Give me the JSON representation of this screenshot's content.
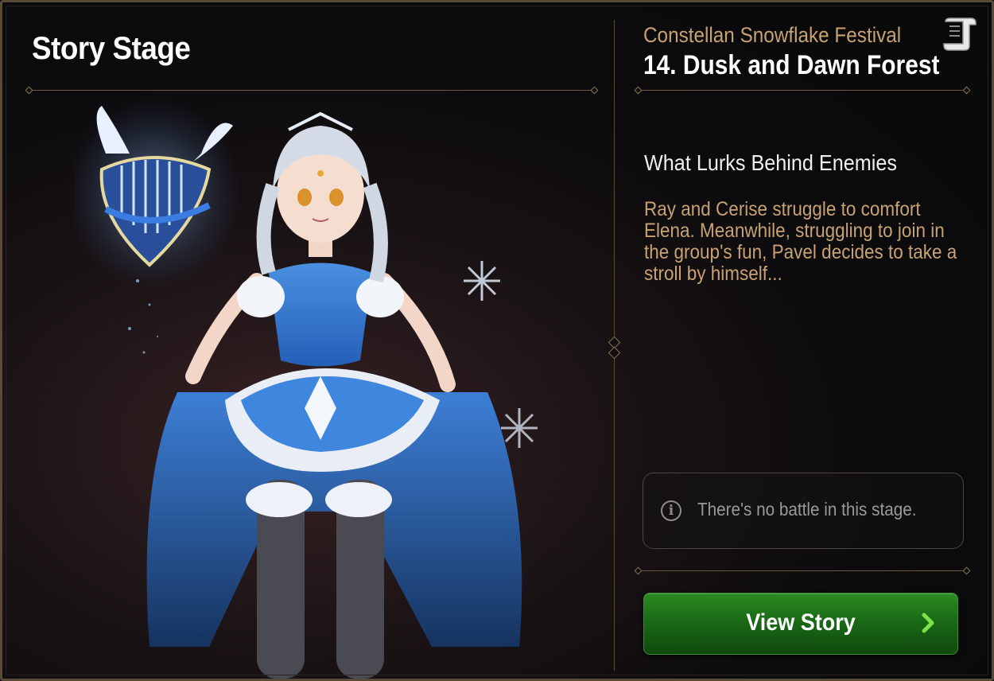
{
  "header": {
    "title": "Story Stage"
  },
  "stage": {
    "event_name": "Constellan Snowflake Festival",
    "stage_name": "14. Dusk and Dawn Forest"
  },
  "story": {
    "heading": "What Lurks Behind Enemies",
    "description": "Ray and Cerise struggle to comfort Elena. Meanwhile, struggling to join in the group's fun, Pavel decides to take a stroll by himself..."
  },
  "notice": {
    "text": "There's no battle in this stage.",
    "icon": "info-icon"
  },
  "actions": {
    "view_story_label": "View Story"
  },
  "colors": {
    "accent": "#c8a272",
    "button_green": "#2c8a22",
    "frame": "#5a4a38"
  }
}
